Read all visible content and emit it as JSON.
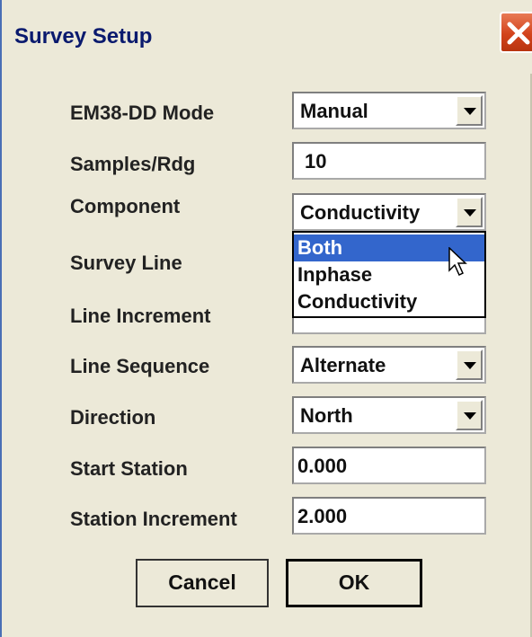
{
  "window": {
    "title": "Survey Setup",
    "close_icon": "close-icon"
  },
  "form": {
    "em38_mode": {
      "label": "EM38-DD Mode",
      "value": "Manual"
    },
    "samples_rdg": {
      "label": "Samples/Rdg",
      "value": "10"
    },
    "component": {
      "label": "Component",
      "value": "Conductivity",
      "options": [
        "Both",
        "Inphase",
        "Conductivity"
      ],
      "highlighted": "Both"
    },
    "survey_line": {
      "label": "Survey Line"
    },
    "line_increment": {
      "label": "Line Increment"
    },
    "line_sequence": {
      "label": "Line Sequence",
      "value": "Alternate"
    },
    "direction": {
      "label": "Direction",
      "value": "North"
    },
    "start_station": {
      "label": "Start Station",
      "value": "0.000"
    },
    "station_increment": {
      "label": "Station Increment",
      "value": "2.000"
    }
  },
  "buttons": {
    "cancel": "Cancel",
    "ok": "OK"
  },
  "colors": {
    "dialog_bg": "#ece9d8",
    "selection": "#3366cc",
    "close_button": "#d3431c",
    "title_text": "#0a1a6e"
  }
}
